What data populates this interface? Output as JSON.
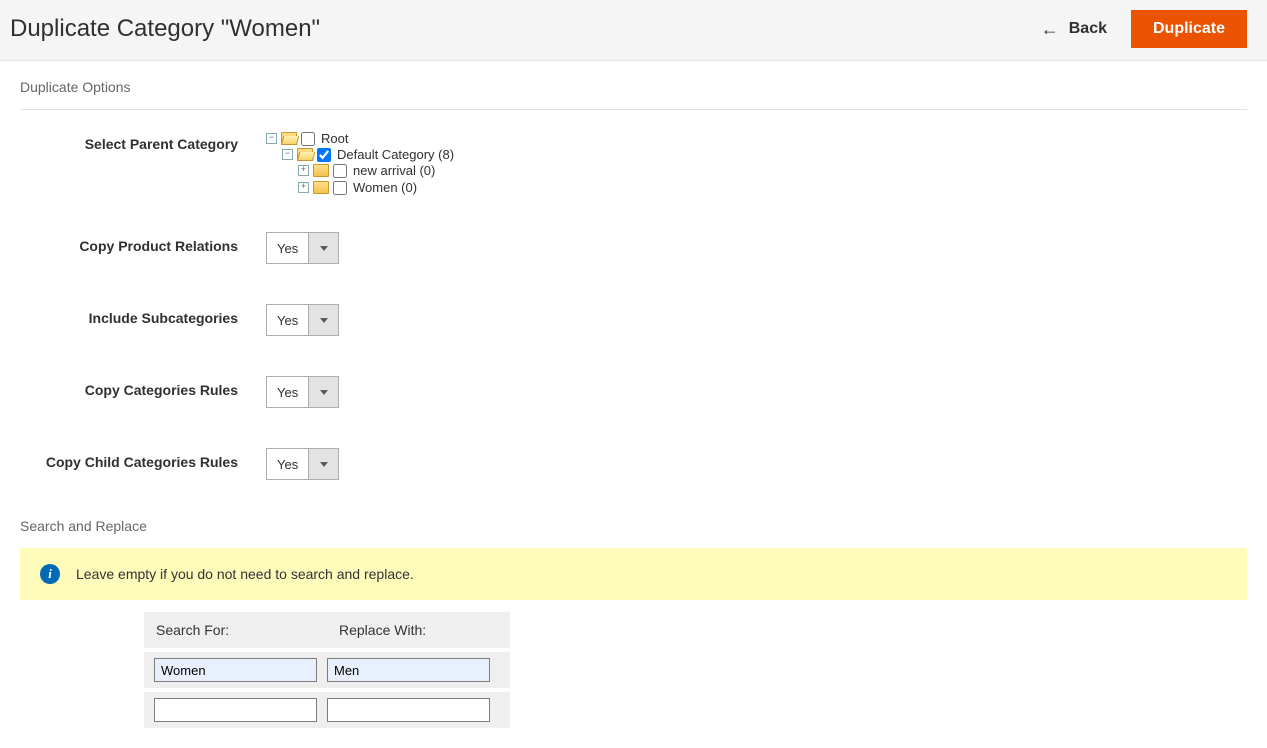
{
  "header": {
    "title": "Duplicate Category \"Women\"",
    "back_label": "Back",
    "duplicate_label": "Duplicate"
  },
  "sections": {
    "duplicate_options_title": "Duplicate Options",
    "search_replace_title": "Search and Replace"
  },
  "fields": {
    "select_parent_label": "Select Parent Category",
    "copy_product_relations": {
      "label": "Copy Product Relations",
      "value": "Yes"
    },
    "include_subcategories": {
      "label": "Include Subcategories",
      "value": "Yes"
    },
    "copy_categories_rules": {
      "label": "Copy Categories Rules",
      "value": "Yes"
    },
    "copy_child_categories_rules": {
      "label": "Copy Child Categories Rules",
      "value": "Yes"
    }
  },
  "tree": {
    "root": {
      "label": "Root",
      "checked": false,
      "expanded": true
    },
    "default_category": {
      "label": "Default Category (8)",
      "checked": true,
      "expanded": true
    },
    "new_arrival": {
      "label": "new arrival (0)",
      "checked": false,
      "expanded": false
    },
    "women": {
      "label": "Women (0)",
      "checked": false,
      "expanded": false
    }
  },
  "search_replace": {
    "info_text": "Leave empty if you do not need to search and replace.",
    "headers": {
      "search_for": "Search For:",
      "replace_with": "Replace With:"
    },
    "rows": [
      {
        "search": "Women",
        "replace": "Men"
      },
      {
        "search": "",
        "replace": ""
      }
    ]
  },
  "icons": {
    "back_arrow": "←"
  }
}
